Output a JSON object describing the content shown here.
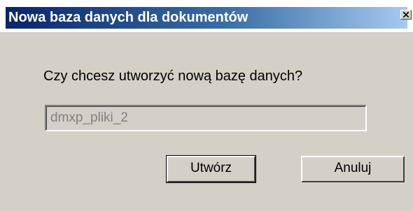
{
  "dialog": {
    "title": "Nowa baza danych dla dokumentów",
    "question": "Czy chcesz utworzyć nową bazę danych?",
    "database_name_value": "dmxp_pliki_2",
    "create_button_label": "Utwórz",
    "cancel_button_label": "Anuluj",
    "close_icon": "close-icon"
  },
  "colors": {
    "title_gradient_start": "#0a246a",
    "title_gradient_end": "#a6caf0",
    "window_background": "#d4d0c8",
    "disabled_text": "#808080"
  }
}
